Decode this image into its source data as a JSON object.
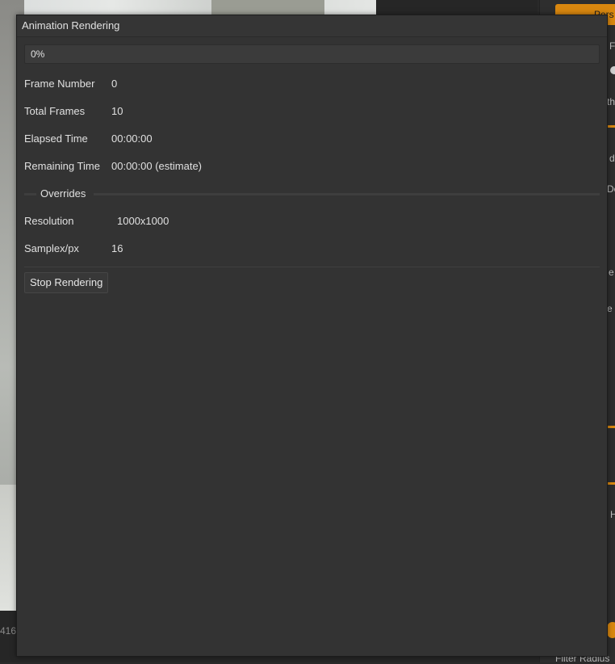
{
  "background": {
    "frame_indicator": "416",
    "right_panel": {
      "top_button": "Pers",
      "texts": [
        "F",
        "th",
        "d",
        "De",
        "e",
        "e",
        "H"
      ],
      "filter_label": "Filter Radius"
    }
  },
  "dialog": {
    "title": "Animation Rendering",
    "progress": {
      "text": "0%",
      "fraction": 0
    },
    "fields": {
      "frame_number": {
        "label": "Frame Number",
        "value": "0"
      },
      "total_frames": {
        "label": "Total Frames",
        "value": "10"
      },
      "elapsed_time": {
        "label": "Elapsed Time",
        "value": "00:00:00"
      },
      "remaining_time": {
        "label": "Remaining Time",
        "value": "00:00:00 (estimate)"
      }
    },
    "overrides": {
      "group_label": "Overrides",
      "resolution": {
        "label": "Resolution",
        "value": "1000x1000"
      },
      "samples": {
        "label": "Samplex/px",
        "value": "16"
      }
    },
    "stop_button": "Stop Rendering"
  },
  "colors": {
    "accent": "#d9870f",
    "dialog_bg": "#333333",
    "text": "#e0e0e0"
  }
}
